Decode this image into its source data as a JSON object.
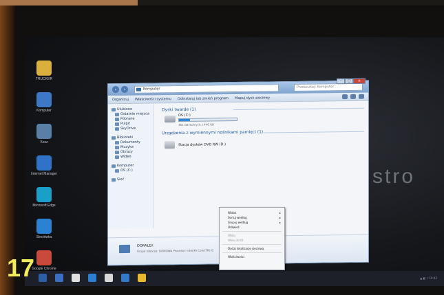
{
  "overlay_number": "17",
  "brand": "stro",
  "desktop_icons": [
    {
      "label": "TRUCKER",
      "color": "#d9b03c"
    },
    {
      "label": "Komputer",
      "color": "#3d78c6"
    },
    {
      "label": "Kosz",
      "color": "#5a7fa6"
    },
    {
      "label": "Internet Manager",
      "color": "#2f73c8"
    },
    {
      "label": "Microsoft Edge",
      "color": "#1aa0c8"
    },
    {
      "label": "Sieciówka",
      "color": "#2b82d3"
    },
    {
      "label": "Google Chrome",
      "color": "#c94a3a"
    }
  ],
  "window": {
    "address": "Komputer",
    "search_placeholder": "Przeszukaj: Komputer",
    "toolbar": [
      "Organizuj",
      "Właściwości systemu",
      "Odinstaluj lub zmień program",
      "Mapuj dysk sieciowy"
    ],
    "nav_pane": [
      {
        "label": "Ulubione",
        "sub": false
      },
      {
        "label": "Ostatnie miejsca",
        "sub": true
      },
      {
        "label": "Pobrane",
        "sub": true
      },
      {
        "label": "Pulpit",
        "sub": true
      },
      {
        "label": "SkyDrive",
        "sub": true
      },
      {
        "label": "Biblioteki",
        "sub": false
      },
      {
        "label": "Dokumenty",
        "sub": true
      },
      {
        "label": "Muzyka",
        "sub": true
      },
      {
        "label": "Obrazy",
        "sub": true
      },
      {
        "label": "Wideo",
        "sub": true
      },
      {
        "label": "Komputer",
        "sub": false
      },
      {
        "label": "OS (C:)",
        "sub": true
      },
      {
        "label": "Sieć",
        "sub": false
      }
    ],
    "section_hdd": "Dyski twarde (1)",
    "drive": {
      "name": "OS (C:)",
      "free_text": "361 GB wolnych z 446 GB",
      "used_fraction": 0.19
    },
    "section_removable": "Urządzenia z wymiennymi nośnikami pamięci (1)",
    "dvd": "Stacja dysków DVD RW (D:)",
    "details": {
      "name": "DORALEX",
      "line2": "Grupa robocza: DOMOWA    Procesor: Intel(R) Core(TM) i5"
    }
  },
  "context_menu": [
    {
      "label": "Widok",
      "arrow": true,
      "dim": false
    },
    {
      "label": "Sortuj według",
      "arrow": true,
      "dim": false
    },
    {
      "label": "Grupuj według",
      "arrow": true,
      "dim": false
    },
    {
      "label": "Odśwież",
      "arrow": false,
      "dim": false
    },
    {
      "sep": true
    },
    {
      "label": "Wklej",
      "arrow": false,
      "dim": true
    },
    {
      "label": "Wklej skrót",
      "arrow": false,
      "dim": true
    },
    {
      "sep": true
    },
    {
      "label": "Dodaj lokalizację sieciową",
      "arrow": false,
      "dim": false
    },
    {
      "sep": true
    },
    {
      "label": "Właściwości",
      "arrow": false,
      "dim": false
    }
  ],
  "taskbar_items": [
    "#2b5fa8",
    "#3a6fc0",
    "#e0e0e0",
    "#2a7fd0",
    "#d8d8d8",
    "#3478c8",
    "#e8b830"
  ],
  "tray_text": "▲ ◧ ♪ 10:42"
}
